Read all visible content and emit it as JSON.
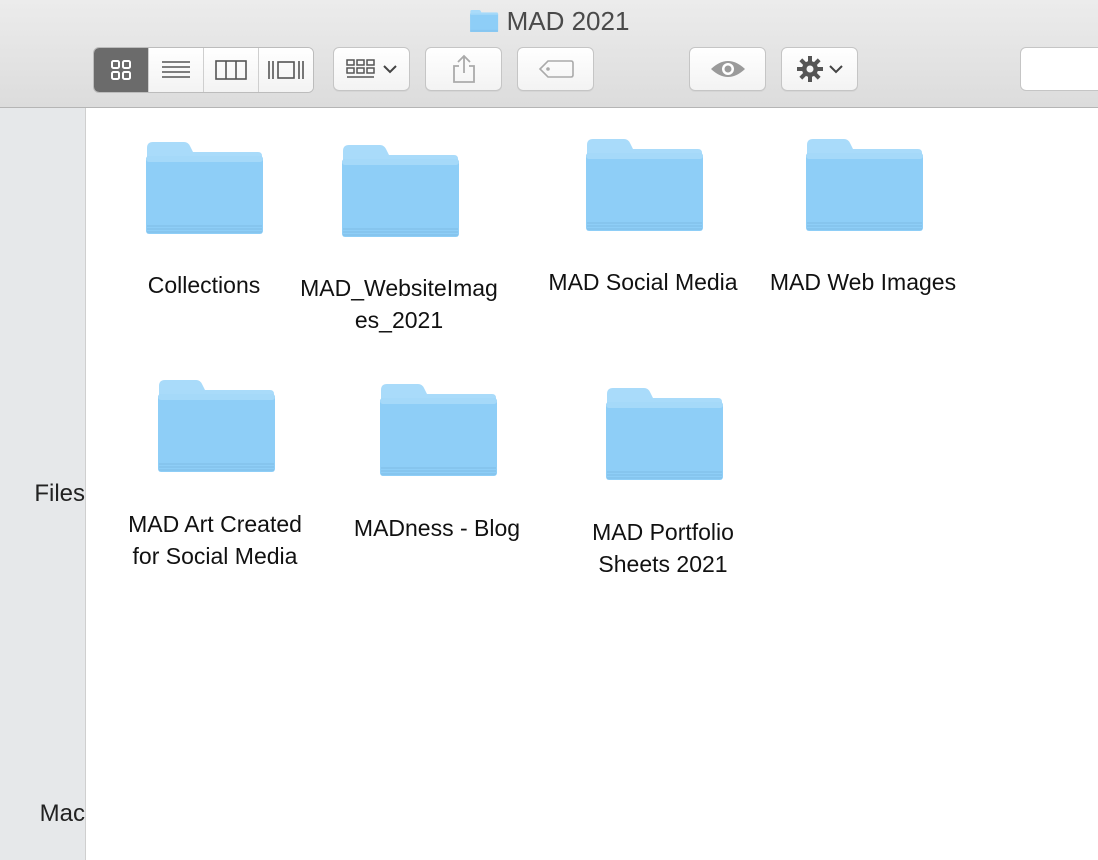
{
  "window": {
    "title": "MAD 2021"
  },
  "toolbar": {
    "view_modes": [
      "icon-view",
      "list-view",
      "column-view",
      "gallery-view"
    ],
    "active_view": "icon-view",
    "group_button_icon": "group-grid-icon",
    "share_icon": "share-icon",
    "tag_icon": "tag-icon",
    "quicklook_icon": "eye-icon",
    "action_icon": "gear-icon"
  },
  "sidebar": {
    "items": [
      {
        "label": "Files"
      },
      {
        "label": "Mac"
      }
    ]
  },
  "folders": [
    {
      "name": "Collections"
    },
    {
      "name": "MAD_WebsiteImages_2021"
    },
    {
      "name": "MAD Social Media"
    },
    {
      "name": "MAD Web Images"
    },
    {
      "name": "MAD Art Created for Social Media"
    },
    {
      "name": "MADness - Blog"
    },
    {
      "name": "MAD Portfolio Sheets 2021"
    }
  ],
  "colors": {
    "folder_front": "#8ecef7",
    "folder_back": "#a9dbfa",
    "active_segment": "#6b6b6b"
  }
}
